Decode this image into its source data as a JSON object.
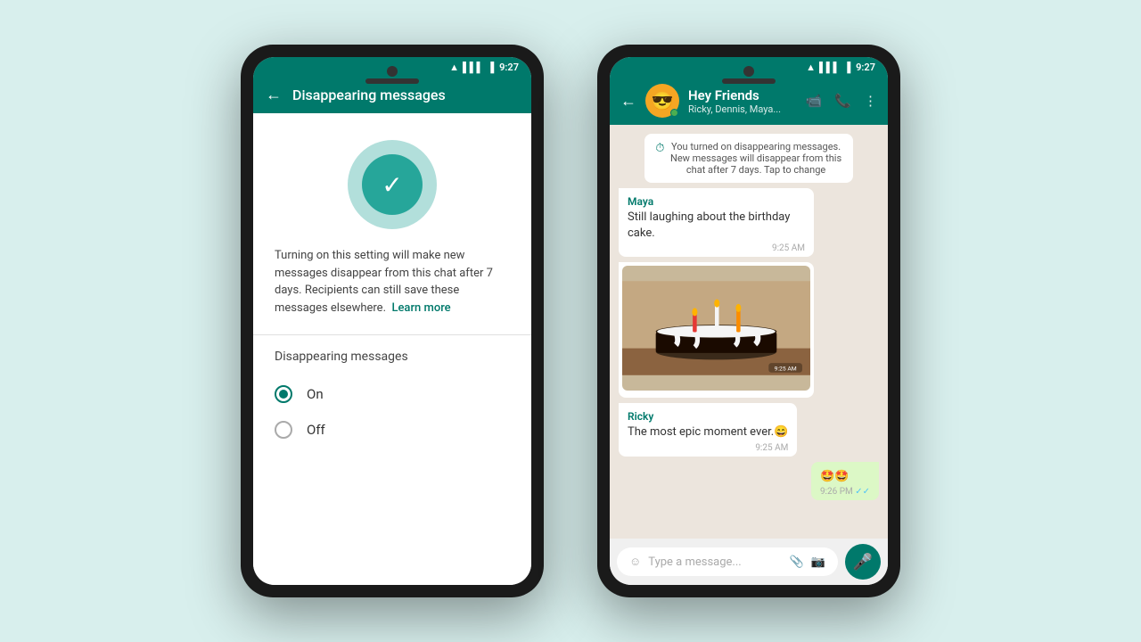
{
  "background": "#d8efed",
  "phone1": {
    "statusBar": {
      "time": "9:27"
    },
    "appBar": {
      "title": "Disappearing messages",
      "backLabel": "←"
    },
    "icon": "✓",
    "description": "Turning on this setting will make new messages disappear from this chat after 7 days. Recipients can still save these messages elsewhere.",
    "learnMore": "Learn more",
    "sectionLabel": "Disappearing messages",
    "options": [
      {
        "label": "On",
        "selected": true
      },
      {
        "label": "Off",
        "selected": false
      }
    ]
  },
  "phone2": {
    "statusBar": {
      "time": "9:27"
    },
    "header": {
      "groupName": "Hey Friends",
      "members": "Ricky, Dennis, Maya...",
      "avatarEmoji": "😎"
    },
    "systemMessage": "You turned on disappearing messages. New messages will disappear from this chat after 7 days. Tap to change",
    "messages": [
      {
        "type": "received",
        "sender": "Maya",
        "text": "Still laughing about the birthday cake.",
        "time": "9:25 AM",
        "hasImage": false
      },
      {
        "type": "received",
        "sender": "",
        "text": "",
        "time": "9:25 AM",
        "hasImage": true
      },
      {
        "type": "received",
        "sender": "Ricky",
        "text": "The most epic moment ever.😄",
        "time": "9:25 AM",
        "hasImage": false
      },
      {
        "type": "sent",
        "sender": "",
        "text": "🤩🤩",
        "time": "9:26 PM",
        "hasImage": false,
        "ticks": "✓✓"
      }
    ],
    "inputPlaceholder": "Type a message...",
    "inputIcons": {
      "emoji": "☺",
      "attach": "📎",
      "camera": "📷",
      "mic": "🎤"
    }
  }
}
